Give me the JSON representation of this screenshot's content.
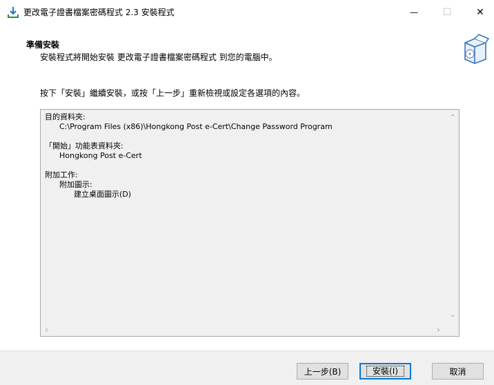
{
  "window": {
    "title": "更改電子證書檔案密碼程式 2.3 安裝程式",
    "minimize_glyph": "—",
    "maximize_glyph": "☐",
    "close_glyph": "✕"
  },
  "header": {
    "title": "準備安裝",
    "subtitle": "安裝程式將開始安裝 更改電子證書檔案密碼程式 到您的電腦中。"
  },
  "instruction": "按下「安裝」繼續安裝，或按「上一步」重新檢視或設定各選項的內容。",
  "summary": {
    "text": "目的資料夾:\n      C:\\Program Files (x86)\\Hongkong Post e-Cert\\Change Password Program\n\n「開始」功能表資料夾:\n      Hongkong Post e-Cert\n\n附加工作:\n      附加圖示:\n            建立桌面圖示(D)"
  },
  "buttons": {
    "back": "上一步(B)",
    "install": "安裝(I)",
    "cancel": "取消"
  },
  "icons": {
    "app": "download-install-icon",
    "header": "software-box-icon"
  },
  "colors": {
    "accent": "#0078d7",
    "footer_bg": "#f0f0f0",
    "summary_bg": "#f0f0f0"
  }
}
